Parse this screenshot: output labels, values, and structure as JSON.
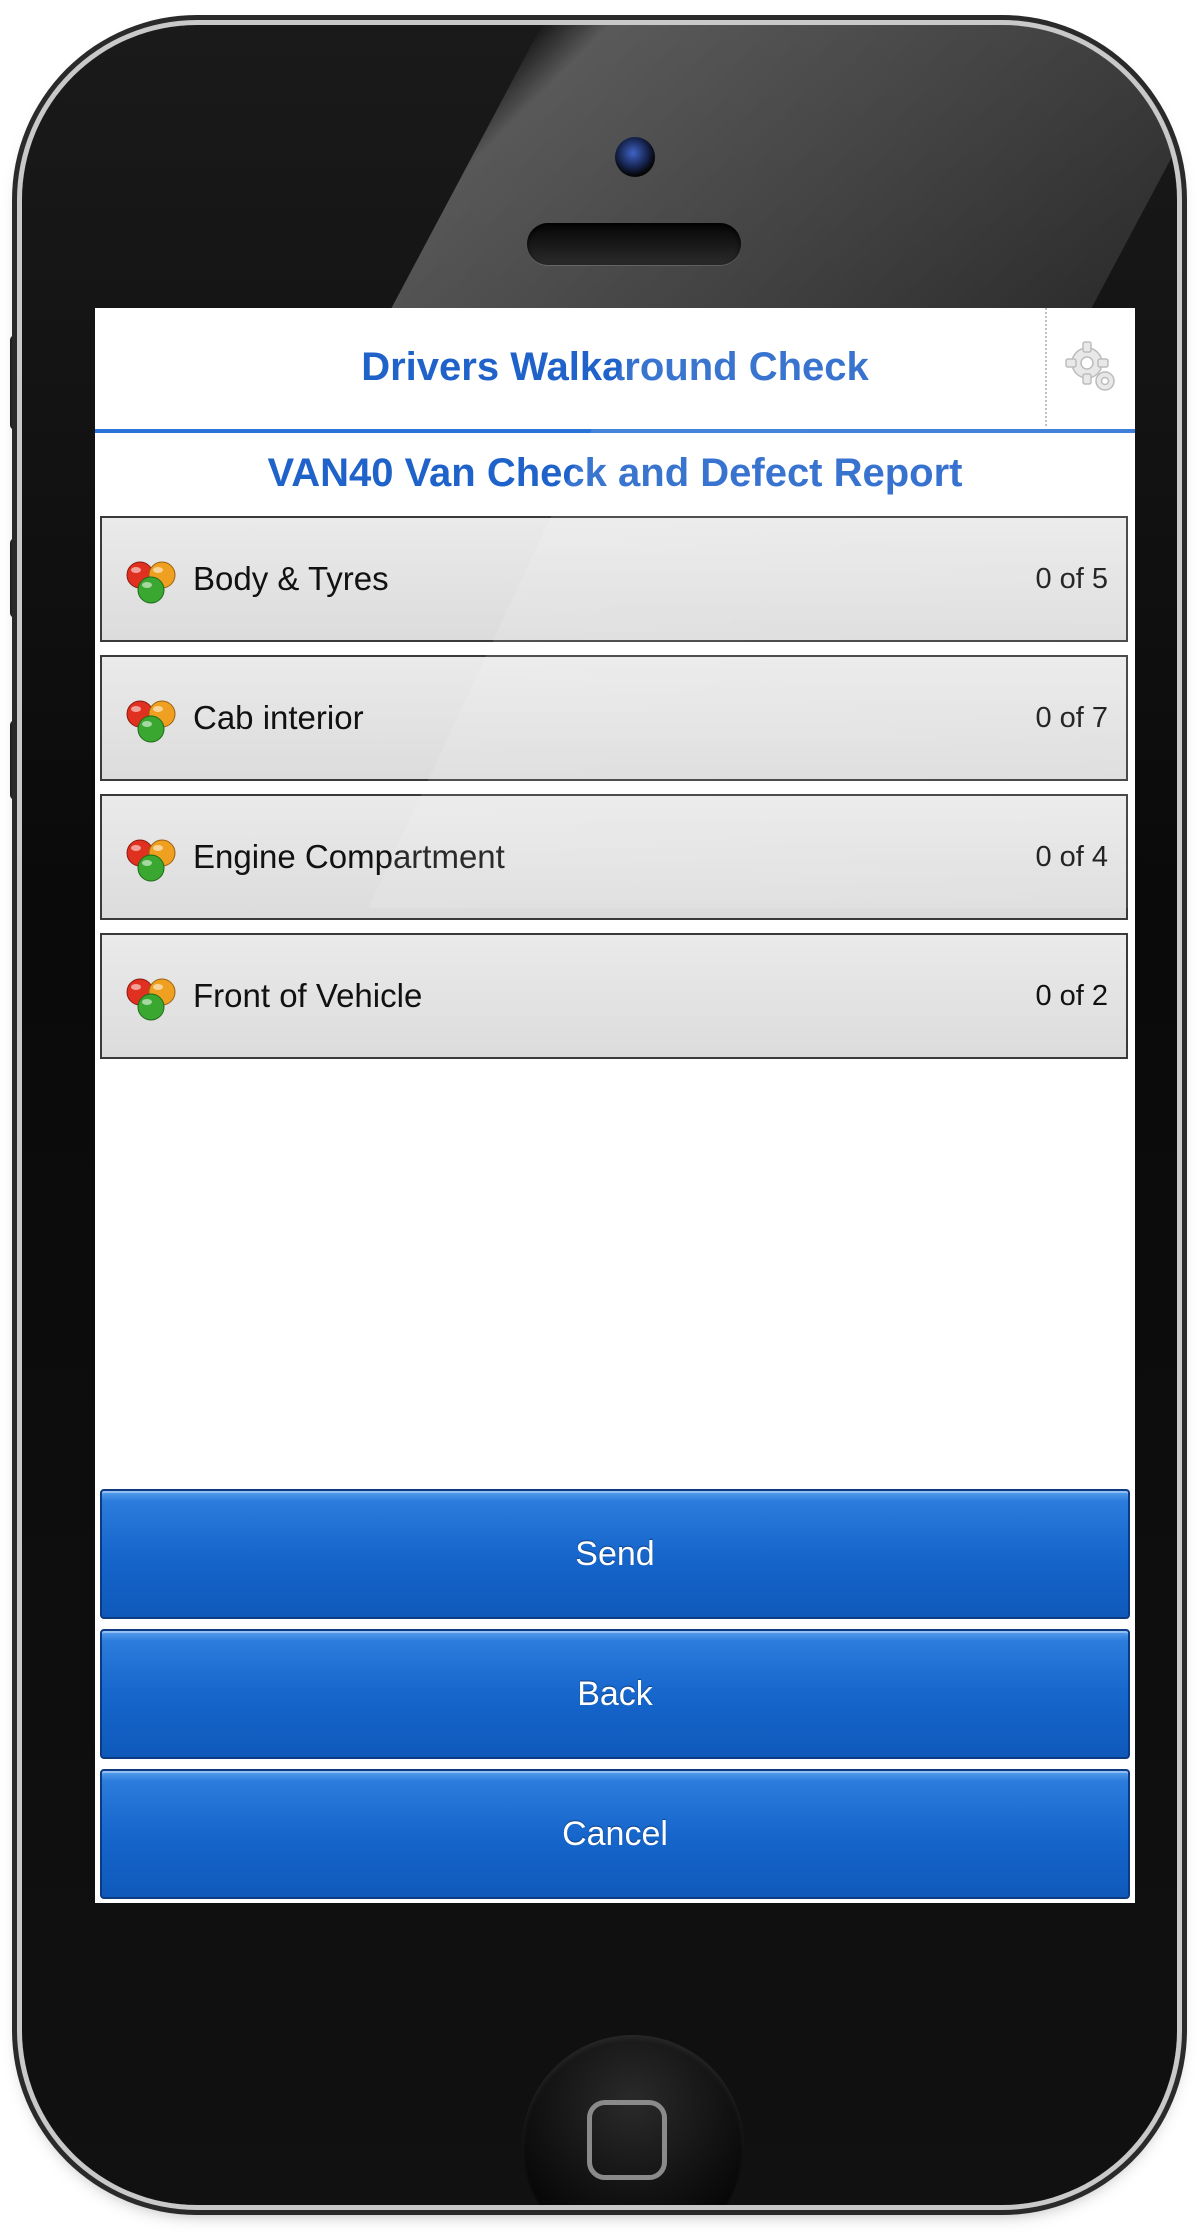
{
  "app": {
    "title": "Drivers Walkaround Check",
    "settings_icon": "gear-icon"
  },
  "report": {
    "title": "VAN40 Van Check and Defect Report"
  },
  "sections": [
    {
      "label": "Body & Tyres",
      "progress": "0 of 5",
      "icon": "status-lights-icon"
    },
    {
      "label": "Cab interior",
      "progress": "0 of 7",
      "icon": "status-lights-icon"
    },
    {
      "label": "Engine Compartment",
      "progress": "0 of 4",
      "icon": "status-lights-icon"
    },
    {
      "label": "Front of Vehicle",
      "progress": "0 of 2",
      "icon": "status-lights-icon"
    }
  ],
  "actions": {
    "send_label": "Send",
    "back_label": "Back",
    "cancel_label": "Cancel"
  },
  "colors": {
    "accent": "#1f62c9",
    "button": "#1666cc",
    "status_red": "#e03020",
    "status_amber": "#f0a020",
    "status_green": "#3aa830"
  }
}
